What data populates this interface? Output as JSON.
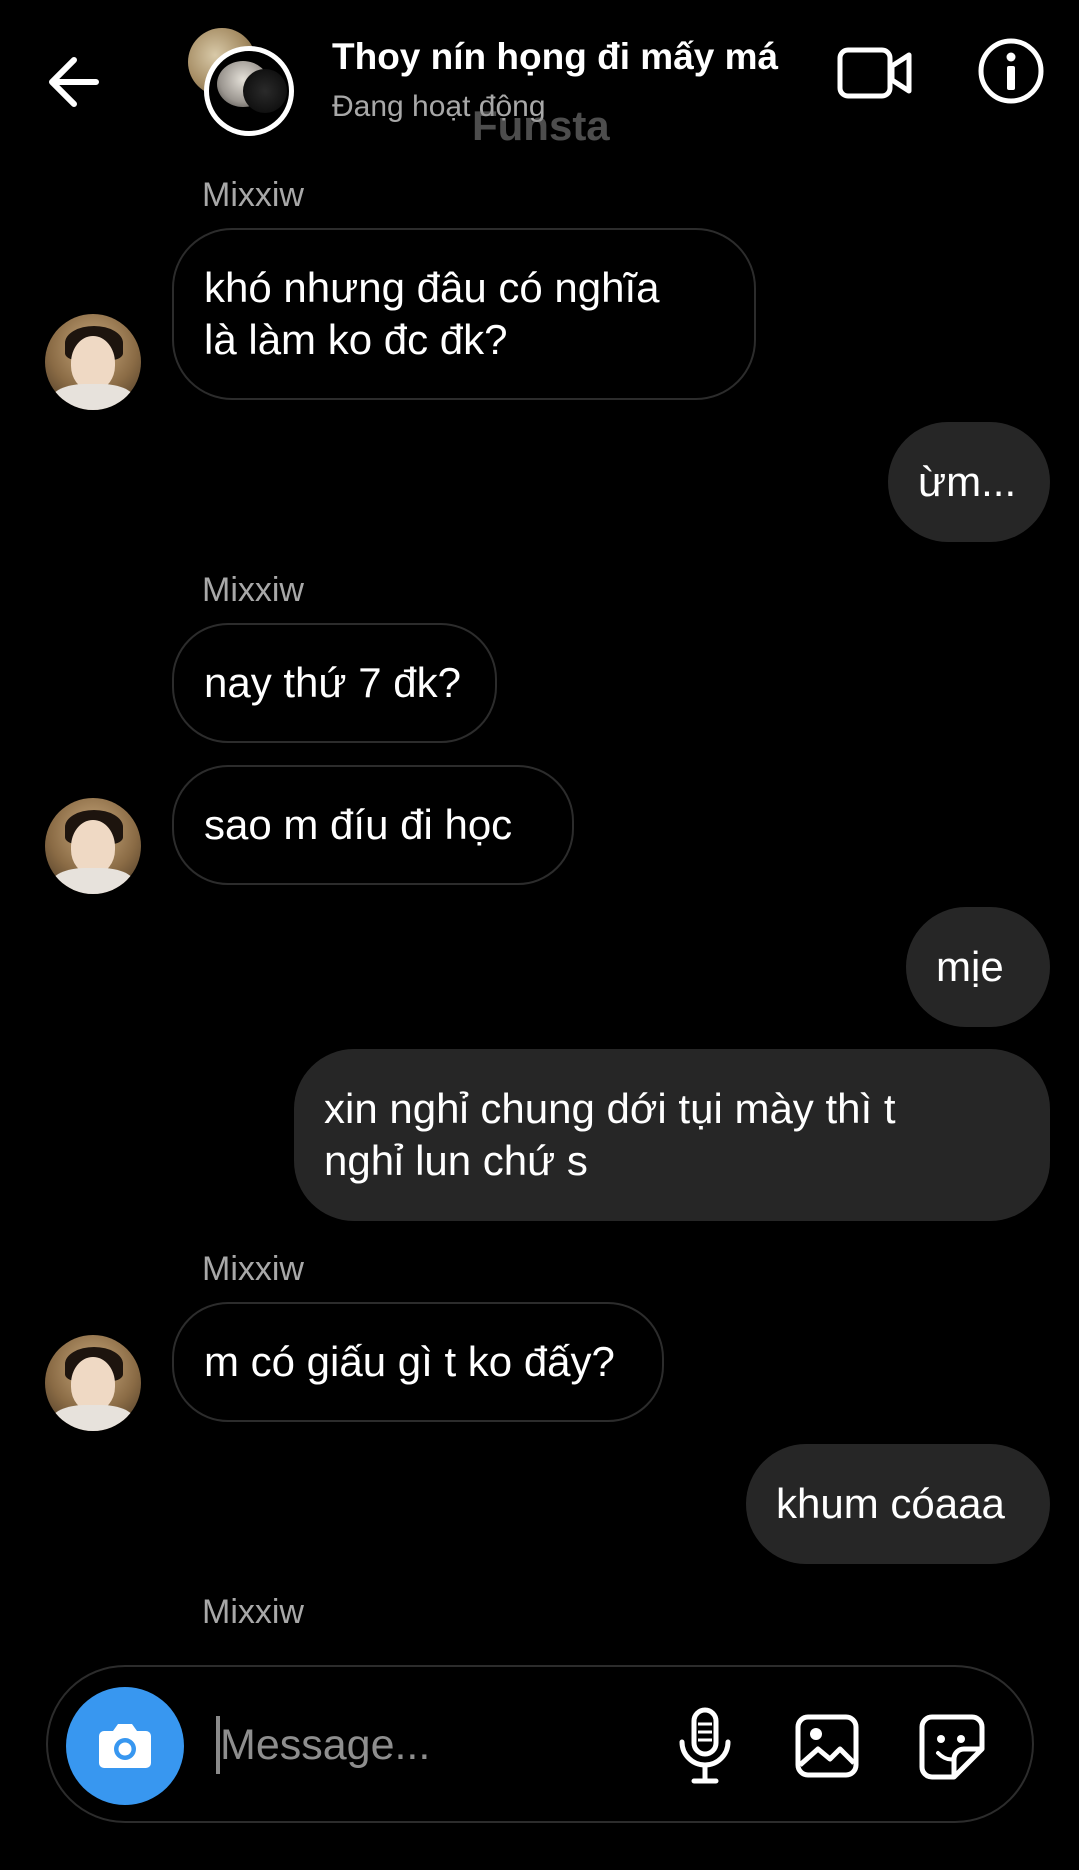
{
  "header": {
    "title": "Thoy nín họng đi mấy má",
    "status": "Đang hoạt động",
    "watermark": "Funsta",
    "icons": [
      "back-arrow-icon",
      "video-call-icon",
      "info-icon"
    ]
  },
  "messages": [
    {
      "type": "sender",
      "text": "Mixxiw"
    },
    {
      "type": "incoming",
      "lines": [
        "khó nhưng đâu có nghĩa",
        "là làm ko đc đk?"
      ]
    },
    {
      "type": "outgoing",
      "lines": [
        "ừm..."
      ]
    },
    {
      "type": "sender",
      "text": "Mixxiw"
    },
    {
      "type": "incoming",
      "lines": [
        "nay thứ 7 đk?"
      ]
    },
    {
      "type": "incoming",
      "lines": [
        "sao m đíu đi học"
      ]
    },
    {
      "type": "outgoing",
      "lines": [
        "mịe"
      ]
    },
    {
      "type": "outgoing",
      "lines": [
        "xin nghỉ chung dới tụi mày thì t",
        "nghỉ lun chứ s"
      ]
    },
    {
      "type": "sender",
      "text": "Mixxiw"
    },
    {
      "type": "incoming",
      "lines": [
        "m có giấu gì t ko đấy?"
      ]
    },
    {
      "type": "outgoing",
      "lines": [
        "khum cóaaa"
      ]
    },
    {
      "type": "sender",
      "text": "Mixxiw"
    }
  ],
  "composer": {
    "placeholder": "Message...",
    "icons": [
      "camera-icon",
      "microphone-icon",
      "gallery-icon",
      "sticker-icon"
    ]
  },
  "colors": {
    "background": "#000000",
    "outgoing_bubble": "#262626",
    "incoming_border": "#2c2c2c",
    "camera_button": "#3897f0",
    "secondary_text": "#a8a8a8"
  }
}
